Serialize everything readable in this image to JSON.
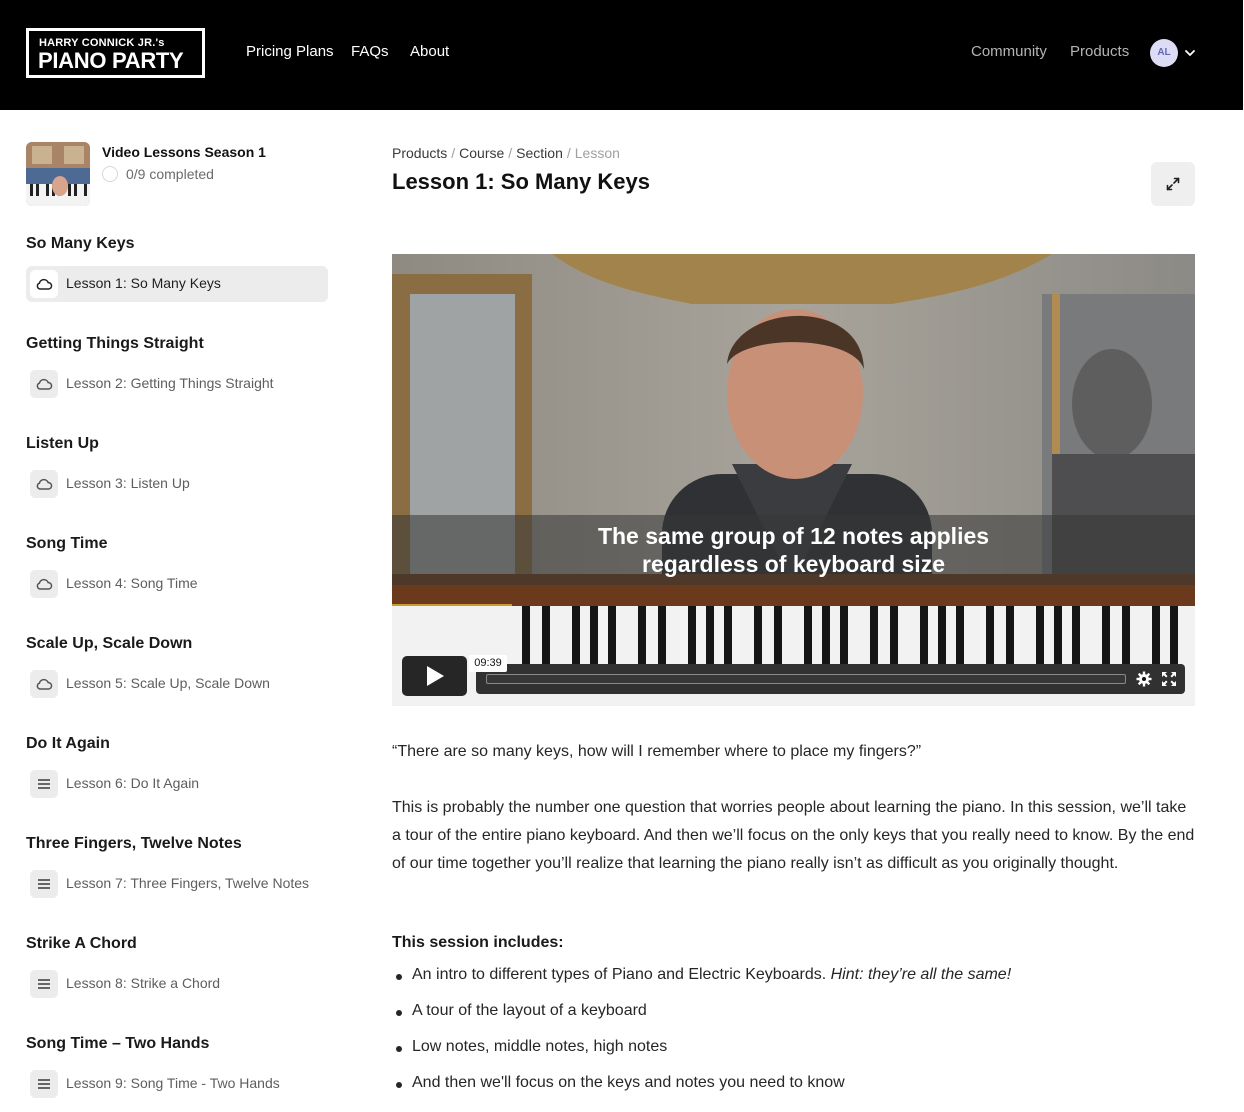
{
  "header": {
    "logo_line1": "HARRY CONNICK JR.'s",
    "logo_line2": "PIANO PARTY",
    "nav": [
      "Pricing Plans",
      "FAQs",
      "About"
    ],
    "nav_right": [
      "Community",
      "Products"
    ],
    "avatar_initials": "AL"
  },
  "sidebar": {
    "course_title": "Video Lessons Season 1",
    "progress": "0/9 completed",
    "sections": [
      {
        "title": "So Many Keys",
        "lesson": "Lesson 1: So Many Keys",
        "icon": "cloud-icon",
        "active": true
      },
      {
        "title": "Getting Things Straight",
        "lesson": "Lesson 2: Getting Things Straight",
        "icon": "cloud-icon"
      },
      {
        "title": "Listen Up",
        "lesson": "Lesson 3: Listen Up",
        "icon": "cloud-icon"
      },
      {
        "title": "Song Time",
        "lesson": "Lesson 4: Song Time",
        "icon": "cloud-icon"
      },
      {
        "title": "Scale Up, Scale Down",
        "lesson": "Lesson 5: Scale Up, Scale Down",
        "icon": "cloud-icon"
      },
      {
        "title": "Do It Again",
        "lesson": "Lesson 6: Do It Again",
        "icon": "text-lines-icon"
      },
      {
        "title": "Three Fingers, Twelve Notes",
        "lesson": "Lesson 7: Three Fingers, Twelve Notes",
        "icon": "text-lines-icon"
      },
      {
        "title": "Strike A Chord",
        "lesson": "Lesson 8: Strike a Chord",
        "icon": "text-lines-icon"
      },
      {
        "title": "Song Time – Two Hands",
        "lesson": "Lesson 9: Song Time - Two Hands",
        "icon": "text-lines-icon"
      }
    ]
  },
  "main": {
    "breadcrumb": [
      "Products",
      "Course",
      "Section",
      "Lesson"
    ],
    "title": "Lesson 1: So Many Keys",
    "video": {
      "caption_line1": "The same group of 12 notes applies",
      "caption_line2": "regardless of keyboard size",
      "duration": "09:39",
      "progress": 0
    },
    "quote": "“There are so many keys, how will I remember where to place my fingers?”",
    "description": "This is probably the number one question that worries people about learning the piano. In this session, we’ll take a tour of the entire piano keyboard. And then we’ll focus on the only keys that you really need to know. By the end of our time together you’ll realize that learning the piano really isn’t as difficult as you originally thought.",
    "includes_title": "This session includes:",
    "includes": [
      {
        "text": "An intro to different types of Piano and Electric Keyboards. ",
        "hint": "Hint: they’re all the same!"
      },
      {
        "text": "A tour of the layout of a keyboard"
      },
      {
        "text": "Low notes, middle notes, high notes"
      },
      {
        "text": "And then we'll focus on the keys and notes you need to know"
      }
    ]
  }
}
